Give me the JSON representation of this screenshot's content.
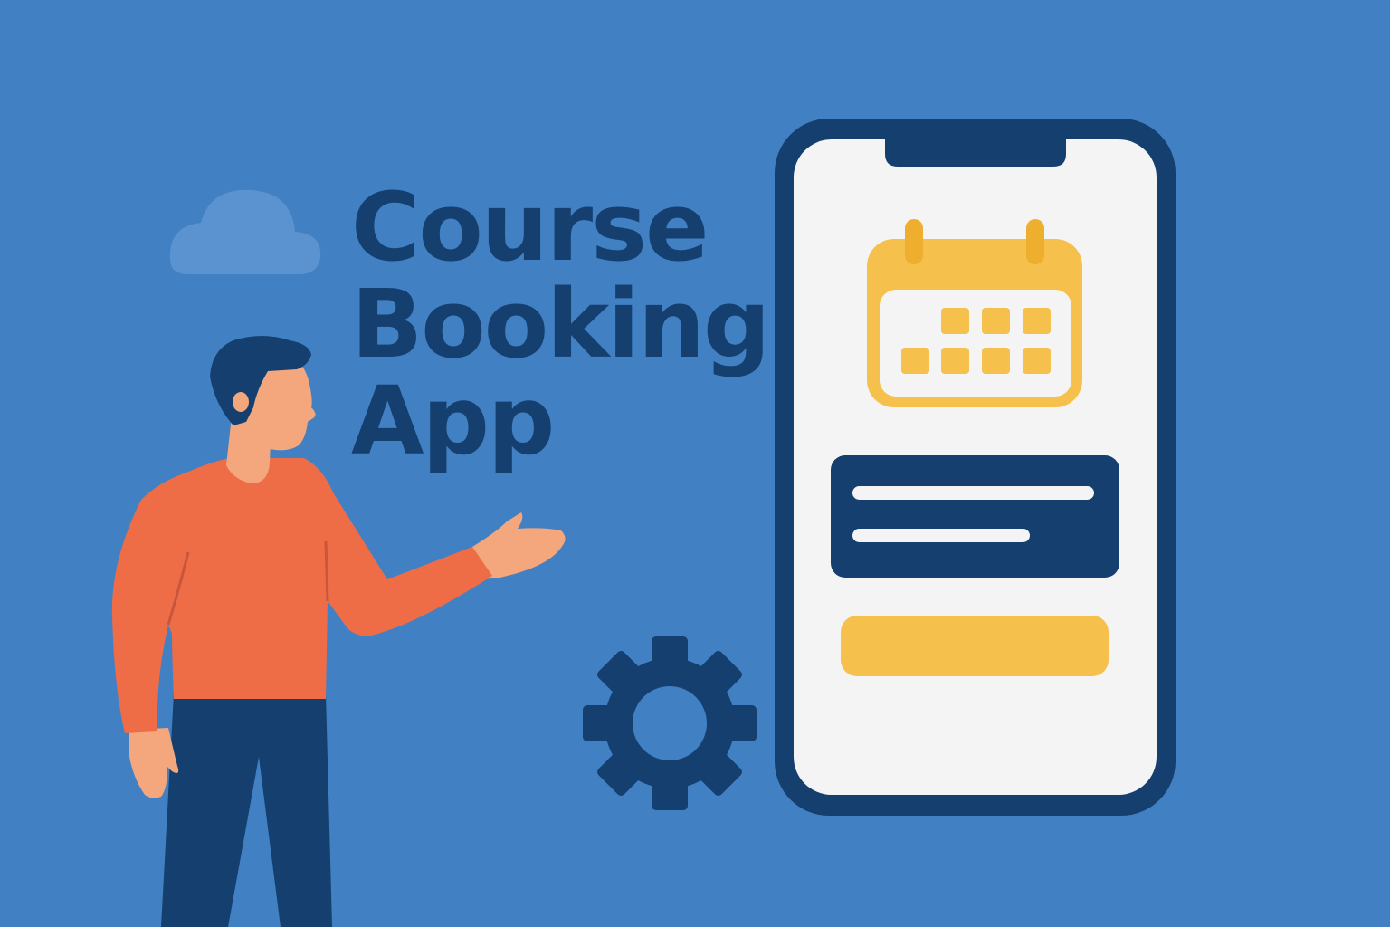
{
  "title_lines": [
    "Course",
    "Booking",
    "App"
  ],
  "colors": {
    "background": "#4280c4",
    "navy": "#143f6f",
    "yellow": "#f6c04d",
    "shirt": "#ee6d47",
    "skin": "#f4a77c",
    "screen": "#f4f4f4",
    "cloud": "#5b93d0"
  },
  "icons": [
    "cloud-icon",
    "gear-icon",
    "calendar-icon"
  ]
}
